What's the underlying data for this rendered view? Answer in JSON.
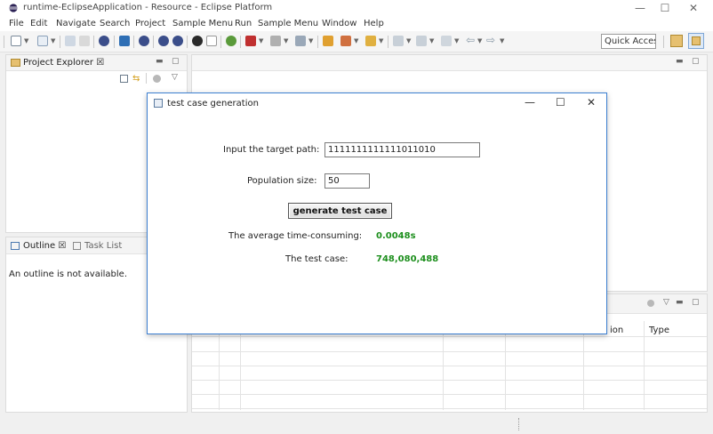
{
  "window": {
    "title": "runtime-EclipseApplication - Resource - Eclipse Platform",
    "minimize_glyph": "—",
    "maximize_glyph": "☐",
    "close_glyph": "✕"
  },
  "menu": [
    "File",
    "Edit",
    "Navigate",
    "Search",
    "Project",
    "Sample Menu",
    "Run",
    "Sample Menu",
    "Window",
    "Help"
  ],
  "toolbar": {
    "quick_access": "Quick Access",
    "icons": [
      "new-icon",
      "save-icon",
      "print-icon",
      "debug-icon",
      "run-icon",
      "external-tools-icon",
      "search-icon",
      "open-type-icon",
      "next-annotation-icon",
      "back-icon",
      "forward-icon"
    ]
  },
  "project_explorer": {
    "title": "Project Explorer ☒"
  },
  "outline": {
    "title": "Outline ☒",
    "task_list_title": "Task List",
    "message": "An outline is not available."
  },
  "bottom_view": {
    "columns": [
      "ion",
      "Type"
    ]
  },
  "dialog": {
    "title": "test case generation",
    "target_path_label": "Input the target path:",
    "target_path_value": "1111111111111011010",
    "population_label": "Population size:",
    "population_value": "50",
    "generate_button": "generate test case",
    "avg_time_label": "The average time-consuming:",
    "avg_time_value": "0.0048s",
    "test_case_label": "The test case:",
    "test_case_value": "748,080,488"
  },
  "colors": {
    "accent_border": "#3c7fd1",
    "result_green": "#1d8f1d"
  }
}
